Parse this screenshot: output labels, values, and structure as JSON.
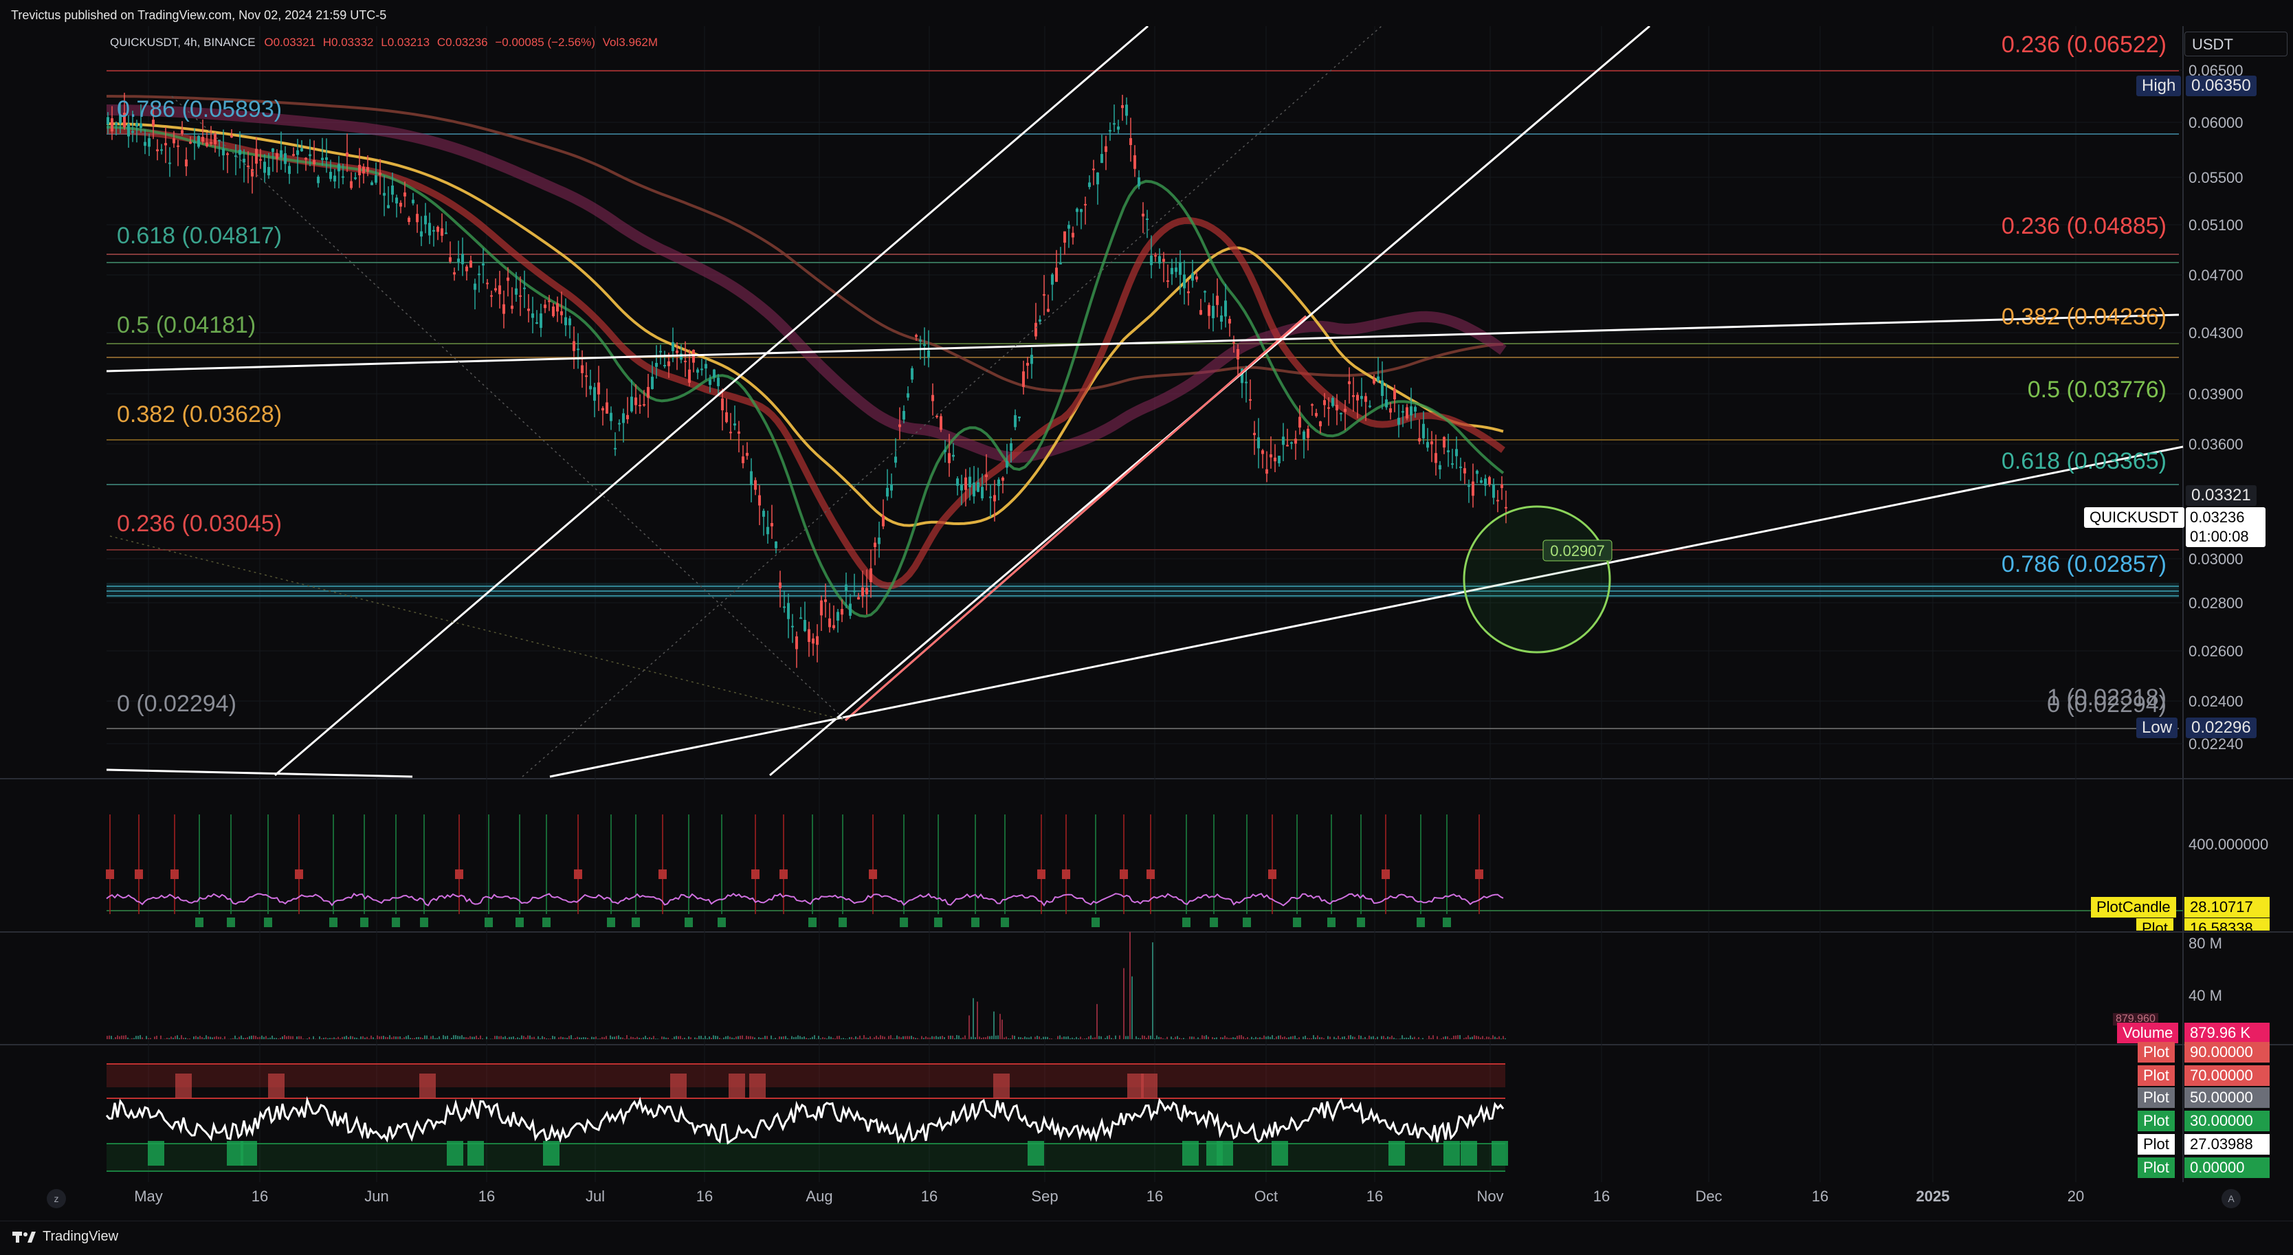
{
  "header": {
    "published": "Trevictus published on TradingView.com, Nov 02, 2024 21:59 UTC-5",
    "symbol_line": "QUICKUSDT, 4h, BINANCE",
    "ohlc": {
      "o": "O0.03321",
      "h": "H0.03332",
      "l": "L0.03213",
      "c": "C0.03236",
      "chg": "−0.00085 (−2.56%)",
      "vol": "Vol3.962M"
    }
  },
  "price_axis": {
    "currency": "USDT",
    "ticks": [
      "0.06500",
      "0.06000",
      "0.05500",
      "0.05100",
      "0.04700",
      "0.04300",
      "0.03900",
      "0.03600",
      "0.03000",
      "0.02800",
      "0.02600",
      "0.02400",
      "0.02240"
    ],
    "high_label": "High",
    "high_value": "0.06350",
    "low_label": "Low",
    "low_value": "0.02296",
    "last_value": "0.03321",
    "symbol_tag": "QUICKUSDT",
    "current": "0.03236",
    "countdown": "01:00:08"
  },
  "fib_left": [
    {
      "text": "0.786 (0.05893)",
      "color": "#4aa4c8"
    },
    {
      "text": "0.618 (0.04817)",
      "color": "#3aa38d"
    },
    {
      "text": "0.5 (0.04181)",
      "color": "#6aa84f"
    },
    {
      "text": "0.382 (0.03628)",
      "color": "#e6a23c"
    },
    {
      "text": "0.236 (0.03045)",
      "color": "#e04a4a"
    },
    {
      "text": "0 (0.02294)",
      "color": "#8a8d96"
    }
  ],
  "fib_right": [
    {
      "text": "0.236 (0.06522)",
      "color": "#f04a4a"
    },
    {
      "text": "0.236 (0.04885)",
      "color": "#f04a4a"
    },
    {
      "text": "0.382 (0.04236)",
      "color": "#f0a23c"
    },
    {
      "text": "0.5 (0.03776)",
      "color": "#7cc04f"
    },
    {
      "text": "0.618 (0.03365)",
      "color": "#3ab39d"
    },
    {
      "text": "0.786 (0.02857)",
      "color": "#4ab4e8"
    },
    {
      "text": "1 (0.02318)",
      "color": "#8a8d96"
    },
    {
      "text": "0 (0.02294)",
      "color": "#8a8d96"
    }
  ],
  "annotation": {
    "circle_value": "0.02907"
  },
  "time_axis": [
    "May",
    "16",
    "Jun",
    "16",
    "Jul",
    "16",
    "Aug",
    "16",
    "Sep",
    "16",
    "Oct",
    "16",
    "Nov",
    "16",
    "Dec",
    "16",
    "2025",
    "20"
  ],
  "indicator1": {
    "axis_tick": "400.000000",
    "label": "PlotCandle",
    "value": "28.10717",
    "label2": "Plot",
    "value2": "16.58338"
  },
  "volume": {
    "ticks": [
      "80 M",
      "40 M"
    ],
    "label": "Volume",
    "value": "879.96 K",
    "ghost": "879.960"
  },
  "rsi": {
    "rows": [
      {
        "label": "Plot",
        "value": "90.00000",
        "color": "#e05252",
        "text": "#ffffff"
      },
      {
        "label": "Plot",
        "value": "70.00000",
        "color": "#e05252",
        "text": "#ffffff"
      },
      {
        "label": "Plot",
        "value": "50.00000",
        "color": "#6b6e78",
        "text": "#ffffff"
      },
      {
        "label": "Plot",
        "value": "30.00000",
        "color": "#1f9d4a",
        "text": "#ffffff"
      },
      {
        "label": "Plot",
        "value": "27.03988",
        "color": "#ffffff",
        "text": "#000000"
      },
      {
        "label": "Plot",
        "value": "0.00000",
        "color": "#1f9d4a",
        "text": "#ffffff"
      }
    ]
  },
  "footer": {
    "brand": "TradingView",
    "left_btn": "z",
    "right_btn": "A"
  },
  "colors": {
    "bg": "#0b0b0d",
    "grid": "#1c1e24",
    "up": "#26a69a",
    "down": "#ef5350"
  }
}
